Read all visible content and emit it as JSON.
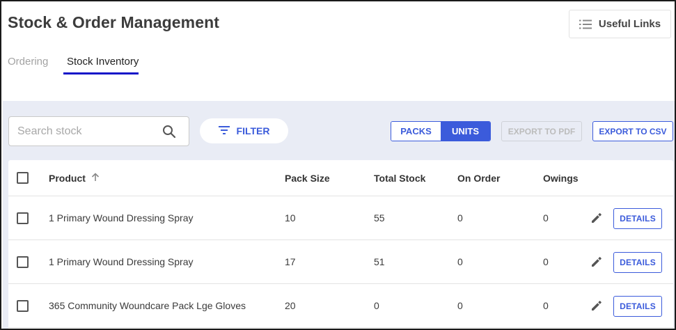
{
  "header": {
    "title": "Stock & Order Management",
    "useful_links_label": "Useful Links",
    "useful_links_icon": "list-icon"
  },
  "tabs": [
    {
      "label": "Ordering",
      "active": false
    },
    {
      "label": "Stock Inventory",
      "active": true
    }
  ],
  "toolbar": {
    "search_placeholder": "Search stock",
    "search_value": "",
    "filter_label": "FILTER",
    "view_toggle": {
      "packs_label": "PACKS",
      "units_label": "UNITS",
      "selected": "UNITS"
    },
    "export_pdf_label": "EXPORT TO PDF",
    "export_pdf_enabled": false,
    "export_csv_label": "EXPORT TO CSV"
  },
  "table": {
    "columns": [
      "Product",
      "Pack Size",
      "Total Stock",
      "On Order",
      "Owings"
    ],
    "sort_column": "Product",
    "sort_direction": "ascending",
    "details_label": "DETAILS",
    "rows": [
      {
        "product": "1 Primary Wound Dressing Spray",
        "pack_size": "10",
        "total_stock": "55",
        "on_order": "0",
        "owings": "0"
      },
      {
        "product": "1 Primary Wound Dressing Spray",
        "pack_size": "17",
        "total_stock": "51",
        "on_order": "0",
        "owings": "0"
      },
      {
        "product": "365 Community Woundcare Pack Lge Gloves",
        "pack_size": "20",
        "total_stock": "0",
        "on_order": "0",
        "owings": "0"
      }
    ]
  },
  "colors": {
    "accent": "#3b5bdb",
    "tab_underline": "#1414c8",
    "panel_background": "#e9ecf5"
  }
}
